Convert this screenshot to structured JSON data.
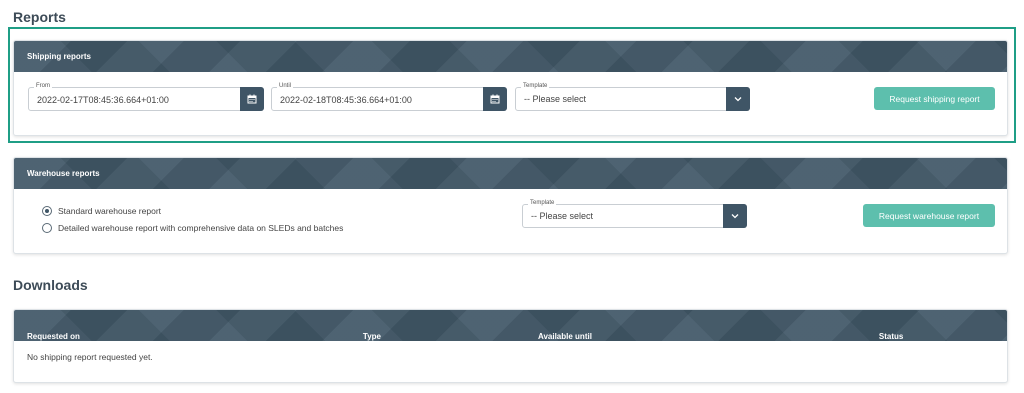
{
  "reports_title": "Reports",
  "shipping": {
    "header": "Shipping reports",
    "from_label": "From",
    "from_value": "2022-02-17T08:45:36.664+01:00",
    "until_label": "Until",
    "until_value": "2022-02-18T08:45:36.664+01:00",
    "template_label": "Template",
    "template_value": "-- Please select",
    "request_button": "Request shipping report"
  },
  "warehouse": {
    "header": "Warehouse reports",
    "options": [
      {
        "label": "Standard warehouse report",
        "selected": true
      },
      {
        "label": "Detailed warehouse report with comprehensive data on SLEDs and batches",
        "selected": false
      }
    ],
    "template_label": "Template",
    "template_value": "-- Please select",
    "request_button": "Request warehouse report"
  },
  "downloads_title": "Downloads",
  "downloads": {
    "columns": [
      "Requested on",
      "Type",
      "Available until",
      "Status"
    ],
    "empty_message": "No shipping report requested yet."
  },
  "colors": {
    "header_bg": "#425868",
    "accent_teal": "#5dbfad",
    "highlight_border": "#1f9e86",
    "icon_button_bg": "#3f5566"
  },
  "icons": [
    "calendar-icon",
    "chevron-down-icon"
  ]
}
